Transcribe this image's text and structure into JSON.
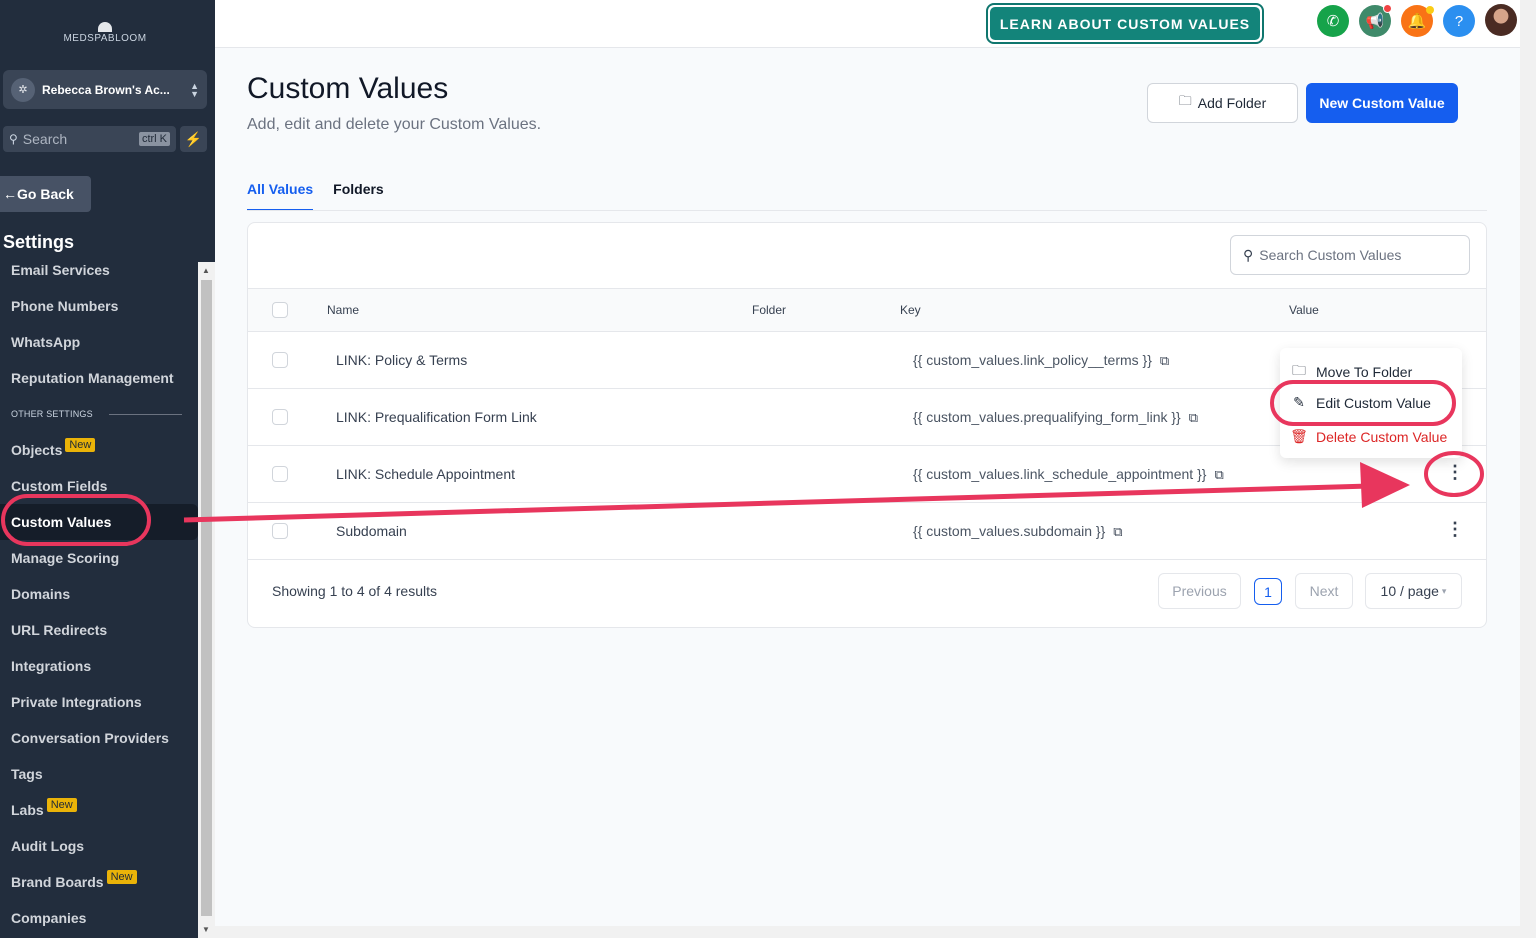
{
  "sidebar": {
    "logo": "MEDSPABLOOM",
    "account_name": "Rebecca Brown's Ac...",
    "search_placeholder": "Search",
    "search_shortcut": "ctrl K",
    "go_back": "Go Back",
    "section_title": "Settings",
    "other_settings_label": "OTHER SETTINGS",
    "items_top": [
      "Email Services",
      "Phone Numbers",
      "WhatsApp",
      "Reputation Management"
    ],
    "items": [
      {
        "label": "Objects",
        "badge": "New"
      },
      {
        "label": "Custom Fields",
        "badge": ""
      },
      {
        "label": "Custom Values",
        "badge": ""
      },
      {
        "label": "Manage Scoring",
        "badge": ""
      },
      {
        "label": "Domains",
        "badge": ""
      },
      {
        "label": "URL Redirects",
        "badge": ""
      },
      {
        "label": "Integrations",
        "badge": ""
      },
      {
        "label": "Private Integrations",
        "badge": ""
      },
      {
        "label": "Conversation Providers",
        "badge": ""
      },
      {
        "label": "Tags",
        "badge": ""
      },
      {
        "label": "Labs",
        "badge": "New"
      },
      {
        "label": "Audit Logs",
        "badge": ""
      },
      {
        "label": "Brand Boards",
        "badge": "New"
      },
      {
        "label": "Companies",
        "badge": ""
      }
    ],
    "active_item": "Custom Values"
  },
  "topbar": {
    "learn_button": "LEARN ABOUT CUSTOM VALUES",
    "icons": [
      "phone-icon",
      "megaphone-icon",
      "bell-icon",
      "help-icon",
      "avatar"
    ]
  },
  "page": {
    "title": "Custom Values",
    "subtitle": "Add, edit and delete your Custom Values.",
    "add_folder": "Add Folder",
    "new_value": "New Custom Value",
    "tabs": [
      "All Values",
      "Folders"
    ],
    "active_tab": "All Values",
    "search_placeholder": "Search Custom Values"
  },
  "table": {
    "columns": [
      "Name",
      "Folder",
      "Key",
      "Value"
    ],
    "rows": [
      {
        "name": "LINK: Policy & Terms",
        "folder": "",
        "key": "{{ custom_values.link_policy__terms }}",
        "value": ""
      },
      {
        "name": "LINK: Prequalification Form Link",
        "folder": "",
        "key": "{{ custom_values.prequalifying_form_link }}",
        "value": ""
      },
      {
        "name": "LINK: Schedule Appointment",
        "folder": "",
        "key": "{{ custom_values.link_schedule_appointment }}",
        "value": ""
      },
      {
        "name": "Subdomain",
        "folder": "",
        "key": "{{ custom_values.subdomain }}",
        "value": ""
      }
    ],
    "footer": "Showing 1 to 4 of 4 results",
    "pagination": {
      "previous": "Previous",
      "current": "1",
      "next": "Next",
      "page_size": "10 / page"
    }
  },
  "context_menu": {
    "items": [
      "Move To Folder",
      "Edit Custom Value",
      "Delete Custom Value"
    ]
  },
  "colors": {
    "sidebar": "#222d3d",
    "primary": "#155eef",
    "teal": "#13847a",
    "annotation": "#e8365d",
    "danger": "#dc2626"
  }
}
